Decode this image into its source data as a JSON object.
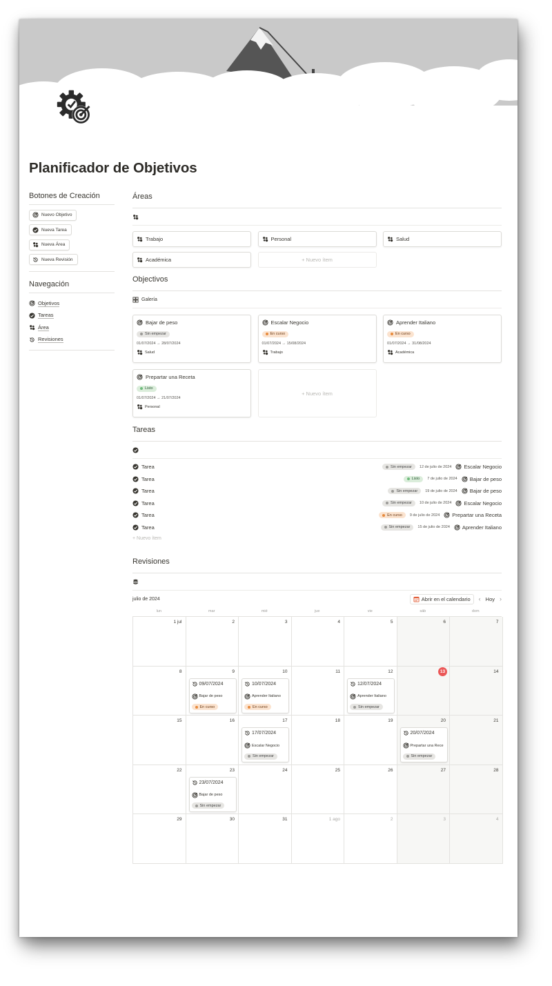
{
  "page": {
    "title": "Planificador de Objetivos"
  },
  "creation": {
    "heading": "Botones de Creación",
    "buttons": [
      "Nuevo Objetivo",
      "Nueva Tarea",
      "Nueva Área",
      "Nueva Revisión"
    ]
  },
  "navigation": {
    "heading": "Navegación",
    "items": [
      "Objetivos",
      "Tareas",
      "Área",
      "Revisiones"
    ]
  },
  "areas": {
    "heading": "Áreas",
    "cards": [
      "Trabajo",
      "Personal",
      "Salud",
      "Académica"
    ],
    "new_item": "+ Nuevo ítem"
  },
  "objectives": {
    "heading": "Objectivos",
    "view_label": "Galería",
    "cards": [
      {
        "name": "Bajar de peso",
        "status": "Sin empezar",
        "status_color": "gray",
        "dates": "01/07/2024 → 28/07/2024",
        "area": "Salud"
      },
      {
        "name": "Escalar Negocio",
        "status": "En curso",
        "status_color": "orange",
        "dates": "01/07/2024 → 15/08/2024",
        "area": "Trabajo"
      },
      {
        "name": "Aprender Italiano",
        "status": "En curso",
        "status_color": "orange",
        "dates": "01/07/2024 → 31/08/2024",
        "area": "Académica"
      },
      {
        "name": "Prepartar una Receta",
        "status": "Listo",
        "status_color": "green",
        "dates": "01/07/2024 → 21/07/2024",
        "area": "Personal"
      }
    ],
    "new_item": "+ Nuevo ítem"
  },
  "tasks": {
    "heading": "Tareas",
    "rows": [
      {
        "name": "Tarea",
        "status": "Sin empezar",
        "status_color": "gray",
        "date": "12 de julio de 2024",
        "objective": "Escalar Negocio"
      },
      {
        "name": "Tarea",
        "status": "Listo",
        "status_color": "green",
        "date": "7 de julio de 2024",
        "objective": "Bajar de peso"
      },
      {
        "name": "Tarea",
        "status": "Sin empezar",
        "status_color": "gray",
        "date": "19 de julio de 2024",
        "objective": "Bajar de peso"
      },
      {
        "name": "Tarea",
        "status": "Sin empezar",
        "status_color": "gray",
        "date": "10 de julio de 2024",
        "objective": "Escalar Negocio"
      },
      {
        "name": "Tarea",
        "status": "En curso",
        "status_color": "orange",
        "date": "9 de julio de 2024",
        "objective": "Prepartar una Receta"
      },
      {
        "name": "Tarea",
        "status": "Sin empezar",
        "status_color": "gray",
        "date": "15 de julio de 2024",
        "objective": "Aprender Italiano"
      }
    ],
    "new_item": "+ Nuevo ítem"
  },
  "reviews": {
    "heading": "Revisiones",
    "month": "julio de 2024",
    "open_calendar": "Abrir en el calendario",
    "today_label": "Hoy",
    "prev": "‹",
    "next": "›",
    "weekdays": [
      "lun",
      "mar",
      "mié",
      "jue",
      "vie",
      "sáb",
      "dom"
    ],
    "days": [
      [
        "1 jul",
        "2",
        "3",
        "4",
        "5",
        "6",
        "7"
      ],
      [
        "8",
        "9",
        "10",
        "11",
        "12",
        "13",
        "14"
      ],
      [
        "15",
        "16",
        "17",
        "18",
        "19",
        "20",
        "21"
      ],
      [
        "22",
        "23",
        "24",
        "25",
        "26",
        "27",
        "28"
      ],
      [
        "29",
        "30",
        "31",
        "1 ago",
        "2",
        "3",
        "4"
      ]
    ],
    "today_day": "13",
    "events": [
      {
        "title": "09/07/2024",
        "objective": "Bajar de peso",
        "status": "En curso",
        "status_color": "orange"
      },
      {
        "title": "10/07/2024",
        "objective": "Aprender Italiano",
        "status": "En curso",
        "status_color": "orange"
      },
      {
        "title": "12/07/2024",
        "objective": "Aprender Italiano",
        "status": "Sin empezar",
        "status_color": "gray"
      },
      {
        "title": "17/07/2024",
        "objective": "Escalar Negocio",
        "status": "Sin empezar",
        "status_color": "gray"
      },
      {
        "title": "20/07/2024",
        "objective": "Prepartar una Rece",
        "status": "Sin empezar",
        "status_color": "gray"
      },
      {
        "title": "23/07/2024",
        "objective": "Bajar de peso",
        "status": "Sin empezar",
        "status_color": "gray"
      }
    ]
  },
  "colors": {
    "today": "#eb5757",
    "gray_tag": "#e6e5e2",
    "orange_tag": "#fbe3cf",
    "green_tag": "#dbeddb"
  }
}
